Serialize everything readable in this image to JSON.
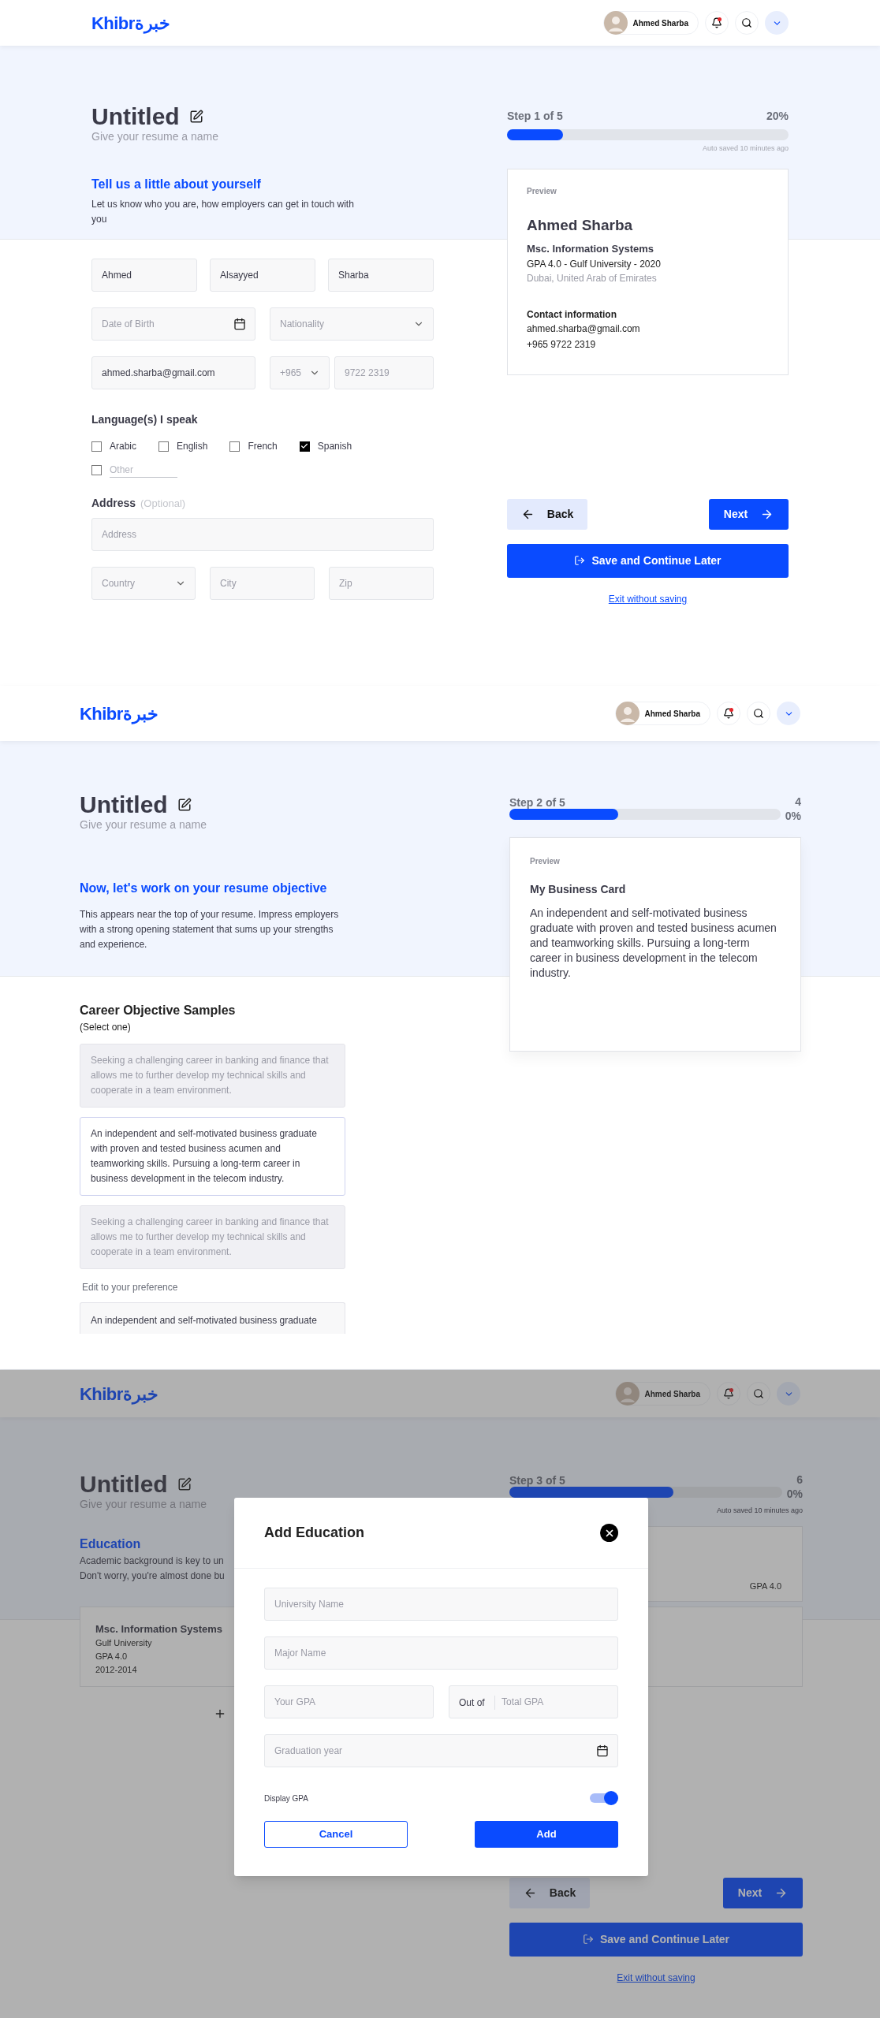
{
  "step_1": {
    "header": {
      "logo_latin": "Khibr",
      "logo_arabic": "خبرة",
      "user_name": "Ahmed Sharba"
    },
    "title": "Untitled",
    "subtitle": "Give your resume a name",
    "section_title": "Tell us a little about yourself",
    "section_text": "Let us know who you are, how employers can get in touch with you",
    "progress": {
      "step": "Step 1 of 5",
      "percent": "20%",
      "level": 0.2,
      "autosave": "Auto saved 10 minutes ago"
    },
    "first_name": "Ahmed",
    "middle_name": "Alsayyed",
    "last_name": "Sharba",
    "birth_date": {
      "placeholder": "Date of Birth"
    },
    "nationality": {
      "placeholder": "Nationality"
    },
    "email": "ahmed.sharba@gmail.com",
    "phone_code": {
      "placeholder": "+965"
    },
    "phone": {
      "placeholder": "9722 2319"
    },
    "languages_label": "Language(s) I speak",
    "languages": [
      {
        "label": "Arabic",
        "checked": false
      },
      {
        "label": "English",
        "checked": false
      },
      {
        "label": "French",
        "checked": false
      },
      {
        "label": "Spanish",
        "checked": true
      }
    ],
    "other_language": {
      "placeholder": "Other",
      "checked": false
    },
    "address_label": "Address",
    "address_optional": "(Optional)",
    "address": {
      "placeholder": "Address"
    },
    "country": {
      "placeholder": "Country"
    },
    "city": {
      "placeholder": "City"
    },
    "zip": {
      "placeholder": "Zip"
    },
    "preview": {
      "label": "Preview",
      "name": "Ahmed Sharba",
      "degree": "Msc. Information Systems",
      "education": "GPA 4.0 - Gulf University - 2020",
      "location": "Dubai, United Arab of Emirates",
      "contact_title": "Contact information",
      "email": "ahmed.sharba@gmail.com",
      "phone": "+965 9722 2319"
    },
    "back": "Back",
    "next": "Next",
    "save": "Save and Continue Later",
    "exit": "Exit without saving"
  },
  "step_2": {
    "header": {
      "logo_latin": "Khibr",
      "logo_arabic": "خبرة",
      "user_name": "Ahmed Sharba"
    },
    "title": "Untitled",
    "subtitle": "Give your resume a name",
    "progress": {
      "step": "Step 2 of 5",
      "percent": "40%",
      "level": 0.4
    },
    "section_title": "Now, let's work on your resume objective",
    "section_text": "This appears near the top of your resume. Impress employers with a strong opening statement that sums up your strengths and experience.",
    "samples_title": "Career Objective Samples",
    "samples_hint": "(Select one)",
    "samples": [
      {
        "text": "Seeking a challenging career in banking and finance that allows me to further develop my technical skills and cooperate in a team environment.",
        "selected": false
      },
      {
        "text": "An independent and self-motivated business graduate with proven and tested business acumen and teamworking skills. Pursuing a long-term career in business development in the telecom industry.",
        "selected": true
      },
      {
        "text": "Seeking a challenging career in banking and finance that allows me to further develop my technical skills and cooperate in a team environment.",
        "selected": false
      }
    ],
    "edit_label": "Edit to your preference",
    "edit_text": "An independent and self-motivated business graduate",
    "preview": {
      "label": "Preview",
      "title": "My Business Card",
      "text": "An independent and self-motivated business graduate with proven and tested business acumen and teamworking skills. Pursuing a long-term career in business development in the telecom industry."
    }
  },
  "step_3": {
    "header": {
      "logo_latin": "Khibr",
      "logo_arabic": "خبرة",
      "user_name": "Ahmed Sharba"
    },
    "title": "Untitled",
    "subtitle": "Give your resume a name",
    "progress": {
      "step": "Step 3 of 5",
      "percent": "60%",
      "level": 0.6,
      "autosave": "Auto saved 10 minutes ago"
    },
    "section_title": "Education",
    "section_lines": [
      "Academic background is key to un",
      "Don't worry, you're almost done bu"
    ],
    "education": {
      "degree": "Msc. Information Systems",
      "university": "Gulf University",
      "gpa": "GPA 4.0",
      "years": "2012-2014"
    },
    "preview_gpa": "GPA 4.0",
    "back": "Back",
    "next": "Next",
    "save": "Save and Continue Later",
    "exit": "Exit without saving",
    "modal": {
      "title": "Add Education",
      "university": {
        "placeholder": "University Name"
      },
      "major": {
        "placeholder": "Major Name"
      },
      "gpa": {
        "placeholder": "Your GPA"
      },
      "out_of": "Out of",
      "total": {
        "placeholder": "Total GPA"
      },
      "graduation": {
        "placeholder": "Graduation year"
      },
      "toggle": {
        "label": "Display GPA",
        "on": true
      },
      "cancel": "Cancel",
      "add": "Add"
    }
  }
}
